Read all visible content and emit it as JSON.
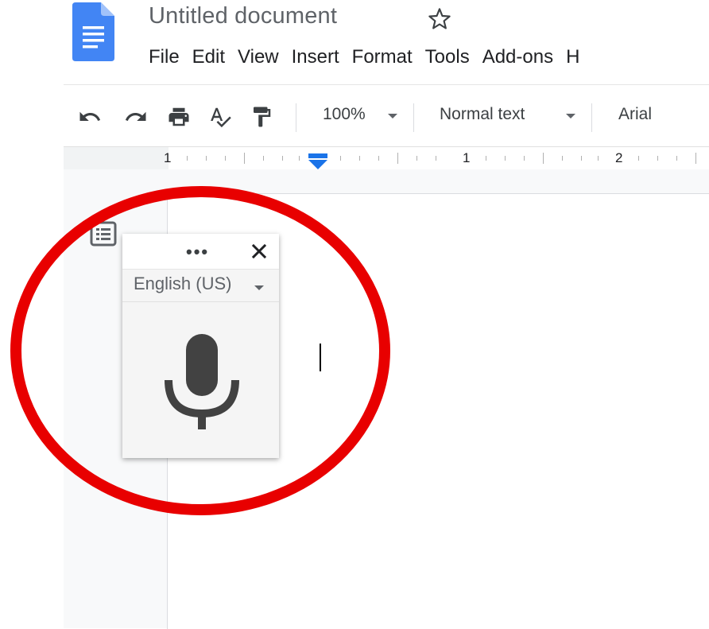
{
  "document": {
    "title": "Untitled document"
  },
  "menubar": {
    "items": [
      "File",
      "Edit",
      "View",
      "Insert",
      "Format",
      "Tools",
      "Add-ons",
      "H"
    ]
  },
  "toolbar": {
    "zoom": "100%",
    "style": "Normal text",
    "font": "Arial",
    "icons": [
      "undo-icon",
      "redo-icon",
      "print-icon",
      "spellcheck-icon",
      "paint-format-icon"
    ]
  },
  "ruler": {
    "labels": [
      "1",
      "1",
      "2"
    ]
  },
  "voice_typing": {
    "language": "English (US)",
    "more_label": "•••",
    "icons": [
      "more-icon",
      "close-icon",
      "microphone-icon"
    ]
  },
  "colors": {
    "docs_blue": "#4285f4",
    "annotation_red": "#e80000",
    "ruler_marker": "#1a73e8",
    "mic_gray": "#424242"
  }
}
